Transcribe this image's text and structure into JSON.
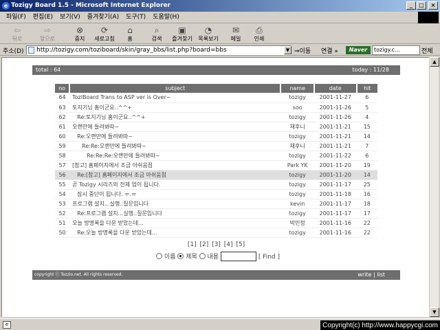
{
  "window": {
    "title": "Tozigy Board 1.5 - Microsoft Internet Explorer"
  },
  "menu": [
    "파일(F)",
    "편집(E)",
    "보기(V)",
    "즐겨찾기(A)",
    "도구(T)",
    "도움말(H)"
  ],
  "toolbar": [
    {
      "label": "뒤로",
      "icon": "back-arrow-icon",
      "disabled": true
    },
    {
      "label": "앞으로",
      "icon": "forward-arrow-icon",
      "disabled": true
    },
    {
      "label": "중지",
      "icon": "stop-icon",
      "disabled": false
    },
    {
      "label": "새로고침",
      "icon": "refresh-icon",
      "disabled": false
    },
    {
      "label": "홈",
      "icon": "home-icon",
      "disabled": false
    },
    {
      "label": "검색",
      "icon": "search-icon",
      "disabled": false
    },
    {
      "label": "즐겨찾기",
      "icon": "favorites-icon",
      "disabled": false
    },
    {
      "label": "목록보기",
      "icon": "history-icon",
      "disabled": false
    },
    {
      "label": "메일",
      "icon": "mail-icon",
      "disabled": false
    },
    {
      "label": "인쇄",
      "icon": "print-icon",
      "disabled": false
    }
  ],
  "address": {
    "label": "주소(D)",
    "url": "http://tozigy.com/toziboard/skin/gray_bbs/list.php?board=bbs",
    "go": "이동",
    "links": "연결 »",
    "naver": "Naver",
    "search_value": "tozigy.c...",
    "search_all": "전체"
  },
  "board": {
    "total_label": "total : 64",
    "today_label": "today : 11/28",
    "columns": [
      "no",
      "subject",
      "name",
      "date",
      "hit"
    ],
    "rows": [
      {
        "no": "64",
        "subject": "TozlBoard Trans to ASP ver is Over~",
        "indent": 0,
        "name": "tozigy",
        "date": "2001-11-27",
        "hit": "6",
        "selected": false
      },
      {
        "no": "63",
        "subject": "토지기님 홈이군요..^^+",
        "indent": 0,
        "name": "soo",
        "date": "2001-11-26",
        "hit": "5",
        "selected": false
      },
      {
        "no": "62",
        "subject": "Re:토지기님 홈이군요..^^+",
        "indent": 1,
        "name": "tozigy",
        "date": "2001-11-26",
        "hit": "4",
        "selected": false
      },
      {
        "no": "61",
        "subject": "오랜만에 들려봐따~",
        "indent": 0,
        "name": "채후니",
        "date": "2001-11-21",
        "hit": "15",
        "selected": false
      },
      {
        "no": "60",
        "subject": "Re:오랜만에 들려봐따~",
        "indent": 1,
        "name": "tozigy",
        "date": "2001-11-21",
        "hit": "14",
        "selected": false
      },
      {
        "no": "59",
        "subject": "Re:Re:오랜만에 들려봐따~",
        "indent": 2,
        "name": "채후니",
        "date": "2001-11-21",
        "hit": "7",
        "selected": false
      },
      {
        "no": "58",
        "subject": "Re:Re:Re:오랜만에 들려봐따~",
        "indent": 3,
        "name": "tozigy",
        "date": "2001-11-22",
        "hit": "6",
        "selected": false
      },
      {
        "no": "57",
        "subject": "[참고] 홈페이지에서 조금 아쉬움점",
        "indent": 0,
        "name": "Park YK",
        "date": "2001-11-20",
        "hit": "19",
        "selected": false
      },
      {
        "no": "56",
        "subject": "Re:[참고] 홈페이지에서 조금 아쉬움점",
        "indent": 1,
        "name": "tozigy",
        "date": "2001-11-20",
        "hit": "14",
        "selected": true
      },
      {
        "no": "55",
        "subject": "곧 Tozigy 시리즈의 전체 업이 됩니다.",
        "indent": 0,
        "name": "tozigy",
        "date": "2001-11-17",
        "hit": "25",
        "selected": false
      },
      {
        "no": "54",
        "subject": "잠시 중단이 됩니다. ㅠ.ㅠ",
        "indent": 1,
        "name": "tozigy",
        "date": "2001-11-18",
        "hit": "16",
        "selected": false
      },
      {
        "no": "53",
        "subject": "프로그램 설치...실행..질문입니다",
        "indent": 0,
        "name": "kevin",
        "date": "2001-11-17",
        "hit": "18",
        "selected": false
      },
      {
        "no": "52",
        "subject": "Re:프로그램 설치...실행..질문입니다",
        "indent": 1,
        "name": "tozigy",
        "date": "2001-11-17",
        "hit": "17",
        "selected": false
      },
      {
        "no": "51",
        "subject": "오늘 방명록을 다운 받았는데...",
        "indent": 0,
        "name": "박민정",
        "date": "2001-11-16",
        "hit": "22",
        "selected": false
      },
      {
        "no": "50",
        "subject": "Re:오늘 방명록을 다운 받았는데...",
        "indent": 1,
        "name": "tozigy",
        "date": "2001-11-16",
        "hit": "22",
        "selected": false
      }
    ],
    "pages": [
      "[1]",
      "[2]",
      "[3]",
      "[4]",
      "[5]"
    ],
    "search_options": [
      {
        "label": "이름",
        "checked": false
      },
      {
        "label": "제목",
        "checked": true
      },
      {
        "label": "내용",
        "checked": false
      }
    ],
    "find_label": "[ Find ]",
    "copyright": "copyright ⓒ Tozzio.net. All rights reserved.",
    "write_label": "write",
    "list_label": "list"
  },
  "status": {
    "copyright": "Copyright(c) http://www.happycgi.com"
  },
  "colors": {
    "title_start": "#0a246a",
    "title_end": "#a6caf0",
    "board_bar": "#6e6e6e",
    "selected_row": "#dedede"
  }
}
